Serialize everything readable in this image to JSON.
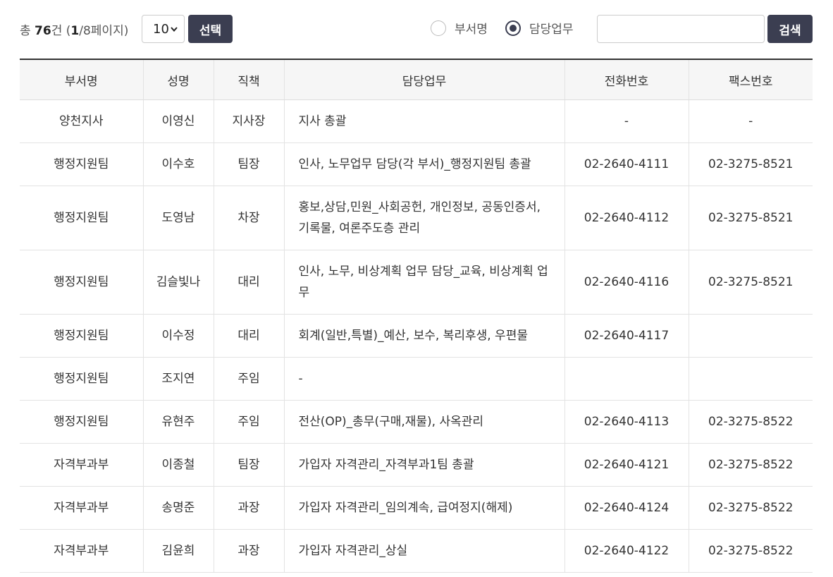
{
  "summary": {
    "prefix": "총 ",
    "total": "76",
    "count_suffix": "건 (",
    "current_page": "1",
    "page_suffix": "/8페이지)"
  },
  "page_size": {
    "selected": "10"
  },
  "buttons": {
    "select_label": "선택",
    "search_label": "검색"
  },
  "search": {
    "options": [
      {
        "label": "부서명",
        "checked": false
      },
      {
        "label": "담당업무",
        "checked": true
      }
    ],
    "value": "",
    "placeholder": ""
  },
  "table": {
    "headers": [
      "부서명",
      "성명",
      "직책",
      "담당업무",
      "전화번호",
      "팩스번호"
    ],
    "rows": [
      {
        "dept": "양천지사",
        "name": "이영신",
        "title": "지사장",
        "duty": "지사 총괄",
        "phone": "-",
        "fax": "-"
      },
      {
        "dept": "행정지원팀",
        "name": "이수호",
        "title": "팀장",
        "duty": "인사, 노무업무 담당(각 부서)_행정지원팀 총괄",
        "phone": "02-2640-4111",
        "fax": "02-3275-8521"
      },
      {
        "dept": "행정지원팀",
        "name": "도영남",
        "title": "차장",
        "duty": "홍보,상담,민원_사회공헌, 개인정보, 공동인증서, 기록물, 여론주도층 관리",
        "phone": "02-2640-4112",
        "fax": "02-3275-8521"
      },
      {
        "dept": "행정지원팀",
        "name": "김슬빛나",
        "title": "대리",
        "duty": "인사, 노무, 비상계획 업무 담당_교육, 비상계획 업무",
        "phone": "02-2640-4116",
        "fax": "02-3275-8521"
      },
      {
        "dept": "행정지원팀",
        "name": "이수정",
        "title": "대리",
        "duty": "회계(일반,특별)_예산, 보수, 복리후생, 우편물",
        "phone": "02-2640-4117",
        "fax": ""
      },
      {
        "dept": "행정지원팀",
        "name": "조지연",
        "title": "주임",
        "duty": "-",
        "phone": "",
        "fax": ""
      },
      {
        "dept": "행정지원팀",
        "name": "유현주",
        "title": "주임",
        "duty": "전산(OP)_총무(구매,재물), 사옥관리",
        "phone": "02-2640-4113",
        "fax": "02-3275-8522"
      },
      {
        "dept": "자격부과부",
        "name": "이종철",
        "title": "팀장",
        "duty": "가입자 자격관리_자격부과1팀 총괄",
        "phone": "02-2640-4121",
        "fax": "02-3275-8522"
      },
      {
        "dept": "자격부과부",
        "name": "송명준",
        "title": "과장",
        "duty": "가입자 자격관리_임의계속, 급여정지(해제)",
        "phone": "02-2640-4124",
        "fax": "02-3275-8522"
      },
      {
        "dept": "자격부과부",
        "name": "김윤희",
        "title": "과장",
        "duty": "가입자 자격관리_상실",
        "phone": "02-2640-4122",
        "fax": "02-3275-8522"
      }
    ]
  }
}
